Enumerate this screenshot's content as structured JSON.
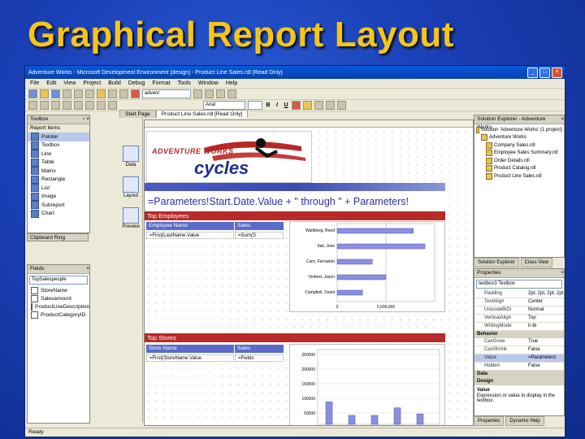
{
  "slide": {
    "title": "Graphical Report Layout"
  },
  "window": {
    "title": "Adventure Works - Microsoft Development Environment [design] - Product Line Sales.rdl [Read Only]",
    "menu": [
      "File",
      "Edit",
      "View",
      "Project",
      "Build",
      "Debug",
      "Format",
      "Tools",
      "Window",
      "Help"
    ],
    "toolbar": {
      "config_combo": "advent",
      "font_combo": "Arial"
    },
    "status": "Ready"
  },
  "toolbox": {
    "title": "Toolbox",
    "section": "Report Items",
    "items": [
      "Pointer",
      "Textbox",
      "Line",
      "Table",
      "Matrix",
      "Rectangle",
      "List",
      "Image",
      "Subreport",
      "Chart"
    ],
    "bottom_title": "Clipboard Ring"
  },
  "fields": {
    "title": "Fields",
    "dataset": "TopSalespeople",
    "items": [
      "StoreName",
      "Salesamount",
      "ProductLineDescription",
      "ProductCategoryID"
    ]
  },
  "document": {
    "tabs": [
      "Start Page",
      "Product Line Sales.rdl [Read Only]"
    ],
    "view_tabs": [
      "Data",
      "Layout",
      "Preview"
    ],
    "logo_line1": "ADVENTURE WORKS",
    "logo_line2": "cycles",
    "expression": "=Parameters!Start.Date.Value + \" through \" + Parameters!",
    "top_employees": {
      "band": "Top Employees",
      "col_employee": "Employee Name",
      "col_sales": "Sales",
      "cell_name": "=First(LastName.Value",
      "cell_sales": "=Sum(S",
      "chart_categories": [
        "Wahlberg, Reed",
        "Sail, Jose",
        "Caro, Fernando",
        "Verbert, Jason",
        "Campbell, David"
      ],
      "chart_axis": [
        "0",
        "5,000,000"
      ]
    },
    "top_stores": {
      "band": "Top Stores",
      "col_store": "Store Name",
      "col_sales": "Sales",
      "cell_name": "=First(StoreName.Value",
      "cell_sales": "=Fields",
      "chart_axis": [
        "250000",
        "200000",
        "150000",
        "100000",
        "50000"
      ]
    }
  },
  "solution_explorer": {
    "title": "Solution Explorer - Adventure Works",
    "items": [
      "Solution 'Adventure Works' (1 project)",
      "Adventure Works",
      "Company Sales.rdl",
      "Employee Sales Summary.rdl",
      "Order Details.rdl",
      "Product Catalog.rdl",
      "Product Line Sales.rdl"
    ],
    "tabs": [
      "Solution Explorer",
      "Class View"
    ]
  },
  "properties": {
    "title": "Properties",
    "object": "textbox3  Textbox",
    "rows": [
      {
        "name": "Padding",
        "value": "2pt, 2pt, 2pt, 2pt"
      },
      {
        "name": "TextAlign",
        "value": "Center"
      },
      {
        "name": "UnicodeBiDi",
        "value": "Normal"
      },
      {
        "name": "VerticalAlign",
        "value": "Top"
      },
      {
        "name": "WritingMode",
        "value": "lr-tb"
      }
    ],
    "cat_behavior": "Behavior",
    "behavior_rows": [
      {
        "name": "CanGrow",
        "value": "True"
      },
      {
        "name": "CanShrink",
        "value": "False"
      },
      {
        "name": "Value",
        "value": "=Parameters"
      },
      {
        "name": "Hidden",
        "value": "False"
      }
    ],
    "cat_data": "Data",
    "cat_design": "Design",
    "desc_title": "Value",
    "desc_text": "Expression or value to display in the textbox.",
    "bottom_tabs": [
      "Properties",
      "Dynamic Help"
    ]
  }
}
